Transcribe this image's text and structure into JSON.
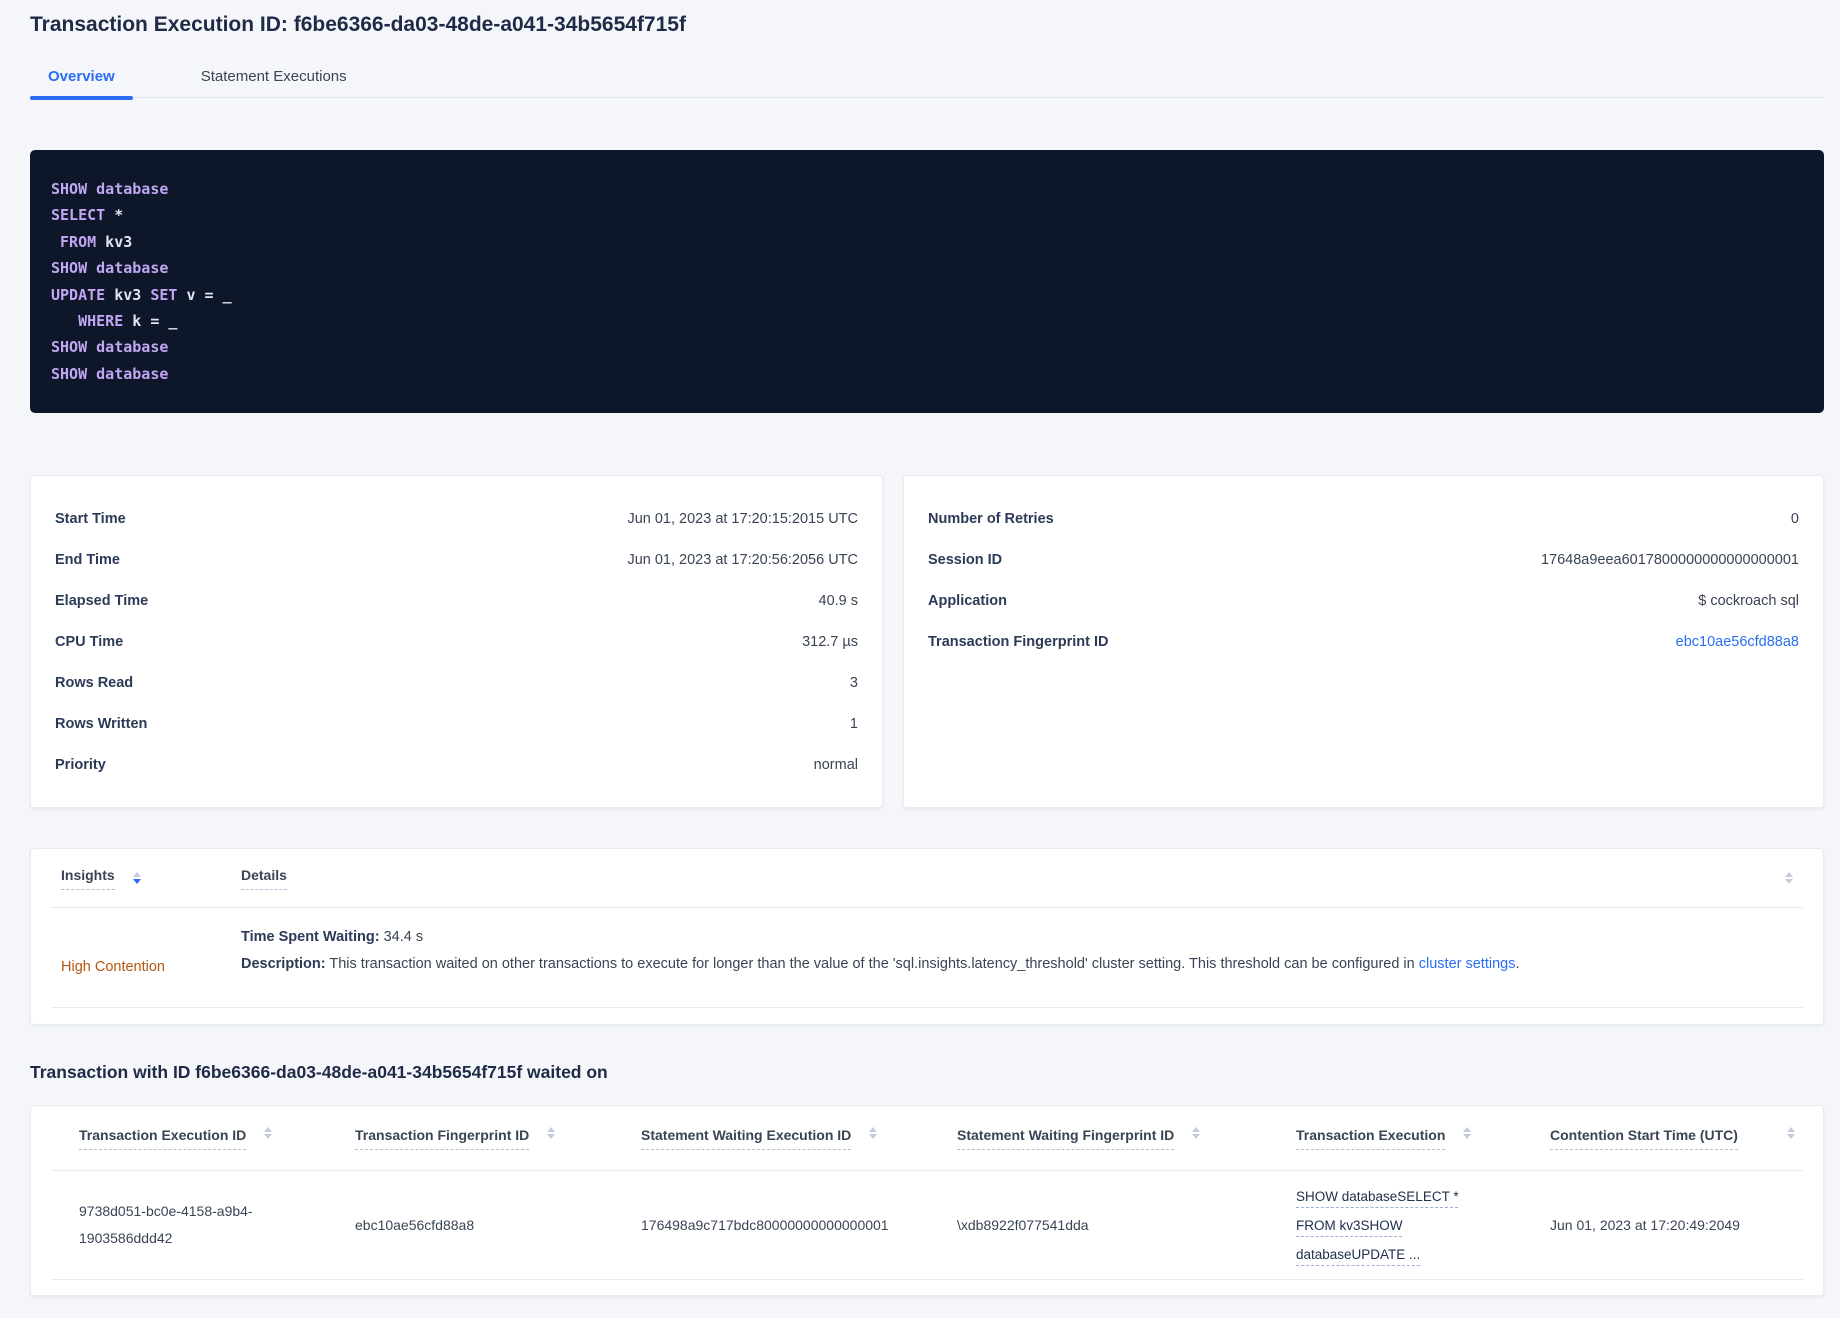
{
  "colors": {
    "accent_blue": "#2a6df4",
    "insight_orange": "#b4560f",
    "sql_keyword": "#c1a6f2",
    "sql_token": "#dee6f1",
    "sql_background": "#0e1729"
  },
  "header": {
    "title": "Transaction Execution ID: f6be6366-da03-48de-a041-34b5654f715f"
  },
  "tabs": {
    "overview": "Overview",
    "statement_executions": "Statement Executions"
  },
  "sql": {
    "lines": [
      [
        {
          "c": "kw",
          "t": "SHOW database"
        }
      ],
      [
        {
          "c": "kw",
          "t": "SELECT"
        },
        {
          "c": "tk",
          "t": " *"
        }
      ],
      [
        {
          "c": "kw",
          "t": " FROM"
        },
        {
          "c": "tk",
          "t": " kv3"
        }
      ],
      [
        {
          "c": "kw",
          "t": "SHOW database"
        }
      ],
      [
        {
          "c": "kw",
          "t": "UPDATE"
        },
        {
          "c": "tk",
          "t": " kv3"
        },
        {
          "c": "kw",
          "t": " SET"
        },
        {
          "c": "tk",
          "t": " v = _"
        }
      ],
      [
        {
          "c": "kw",
          "t": "   WHERE"
        },
        {
          "c": "tk",
          "t": " k = _"
        }
      ],
      [
        {
          "c": "kw",
          "t": "SHOW database"
        }
      ],
      [
        {
          "c": "kw",
          "t": "SHOW database"
        }
      ]
    ]
  },
  "summary_left": {
    "rows": [
      {
        "label": "Start Time",
        "value": "Jun 01, 2023 at 17:20:15:2015 UTC"
      },
      {
        "label": "End Time",
        "value": "Jun 01, 2023 at 17:20:56:2056 UTC"
      },
      {
        "label": "Elapsed Time",
        "value": "40.9 s"
      },
      {
        "label": "CPU Time",
        "value": "312.7 µs"
      },
      {
        "label": "Rows Read",
        "value": "3"
      },
      {
        "label": "Rows Written",
        "value": "1"
      },
      {
        "label": "Priority",
        "value": "normal"
      }
    ]
  },
  "summary_right": {
    "rows": [
      {
        "label": "Number of Retries",
        "value": "0"
      },
      {
        "label": "Session ID",
        "value": "17648a9eea6017800000000000000001"
      },
      {
        "label": "Application",
        "value": "$ cockroach sql"
      }
    ],
    "fingerprint": {
      "label": "Transaction Fingerprint ID",
      "value": "ebc10ae56cfd88a8"
    }
  },
  "insights": {
    "columns": {
      "insights": "Insights",
      "details": "Details"
    },
    "row": {
      "insight": "High Contention",
      "waiting_label": "Time Spent Waiting:",
      "waiting_value": "34.4 s",
      "description_label": "Description:",
      "description_text": "This transaction waited on other transactions to execute for longer than the value of the 'sql.insights.latency_threshold' cluster setting. This threshold can be configured in ",
      "description_link": "cluster settings",
      "description_suffix": "."
    }
  },
  "waited_on": {
    "heading": "Transaction with ID f6be6366-da03-48de-a041-34b5654f715f waited on",
    "columns": [
      "Transaction Execution ID",
      "Transaction Fingerprint ID",
      "Statement Waiting Execution ID",
      "Statement Waiting Fingerprint ID",
      "Transaction Execution",
      "Contention Start Time (UTC)"
    ],
    "row": {
      "transaction_execution_id": "9738d051-bc0e-4158-a9b4-1903586ddd42",
      "transaction_fingerprint_id": "ebc10ae56cfd88a8",
      "statement_waiting_execution_id": "176498a9c717bdc80000000000000001",
      "statement_waiting_fingerprint_id": "\\xdb8922f077541dda",
      "transaction_execution": "SHOW databaseSELECT * FROM kv3SHOW databaseUPDATE ...",
      "contention_start_time": "Jun 01, 2023 at 17:20:49:2049"
    }
  }
}
